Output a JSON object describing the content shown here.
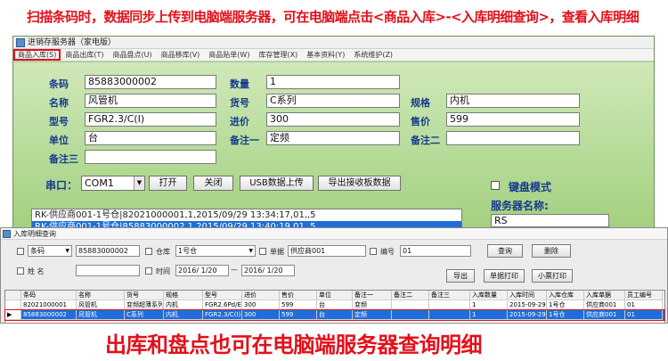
{
  "captions": {
    "top": "扫描条码时，数据同步上传到电脑端服务器，可在电脑端点击<商品入库>-<入库明细查询>，查看入库明细",
    "bottom": "出库和盘点也可在电脑端服务器查询明细"
  },
  "main_window": {
    "title": "进销存服务器（家电版）",
    "menu": [
      "商品入库(S)",
      "商品出库(T)",
      "商品盘点(U)",
      "商品移库(V)",
      "商品贴单(W)",
      "库存管理(X)",
      "基本资料(Y)",
      "系统维护(Z)"
    ],
    "form": {
      "barcode_label": "条码",
      "barcode_value": "85883000002",
      "qty_label": "数量",
      "qty_value": "1",
      "name_label": "名称",
      "name_value": "风管机",
      "model_no_label": "货号",
      "model_no_value": "C系列",
      "spec_label": "规格",
      "spec_value": "内机",
      "type_label": "型号",
      "type_value": "FGR2.3/C(I)",
      "cost_label": "进价",
      "cost_value": "300",
      "price_label": "售价",
      "price_value": "599",
      "unit_label": "单位",
      "unit_value": "台",
      "note1_label": "备注一",
      "note1_value": "定频",
      "note2_label": "备注二",
      "note2_value": "",
      "note3_label": "备注三",
      "note3_value": ""
    },
    "port_label": "串口：",
    "port_value": "COM1",
    "buttons": {
      "open": "打开",
      "close": "关闭",
      "usb": "USB数据上传",
      "export": "导出接收板数据"
    },
    "log": [
      "RK-供应商001-1号仓|82021000001,1,2015/09/29 13:34:17,01,,5",
      "RK-供应商001-1号仓|85883000002,1,2015/09/29 13:40:19,01,,5"
    ],
    "keyboard_mode_label": "键盘模式",
    "server_name_label": "服务器名称:",
    "server_name_value": "RS"
  },
  "query_window": {
    "title": "入库明细查询",
    "filters": {
      "barcode_select": "条码",
      "barcode_value": "85883000002",
      "warehouse_label": "仓库",
      "warehouse_value": "1号仓",
      "order_label": "单据",
      "order_value": "供应商001",
      "code_label": "编号",
      "code_value": "01",
      "name_label": "姓  名",
      "time_label": "时间",
      "date_from": "2016/ 1/20",
      "date_to": "2016/ 1/20"
    },
    "buttons": {
      "query": "查询",
      "delete": "删除",
      "export": "导出",
      "print_doc": "单据打印",
      "print_ticket": "小票打印"
    },
    "columns": [
      "条码",
      "名称",
      "货号",
      "规格",
      "型号",
      "进价",
      "售价",
      "单位",
      "备注一",
      "备注二",
      "备注三",
      "入库数量",
      "入库时间",
      "入库仓库",
      "入库单据",
      "员工编号"
    ],
    "rows": [
      [
        "82021000001",
        "风管机",
        "变频超薄系列",
        "内机",
        "FGR2.6Pd/E",
        "300",
        "599",
        "台",
        "变频",
        "",
        "",
        "1",
        "2015-09-29",
        "1号仓",
        "供应商001",
        "01"
      ],
      [
        "85883000002",
        "风管机",
        "C系列",
        "内机",
        "FGR2.3/C(I)",
        "300",
        "599",
        "台",
        "定频",
        "",
        "",
        "1",
        "2015-09-29",
        "1号仓",
        "供应商001",
        "01"
      ]
    ]
  }
}
